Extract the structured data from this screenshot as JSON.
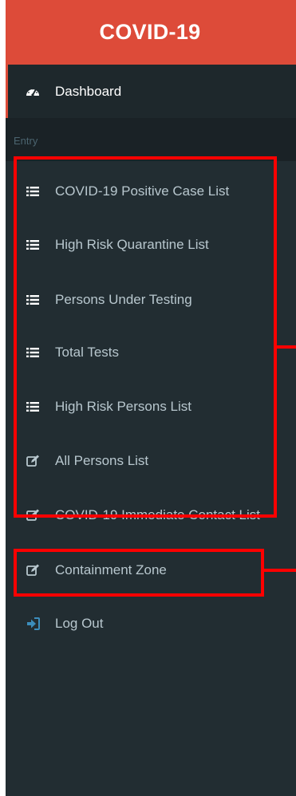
{
  "header": {
    "title": "COVID-19"
  },
  "sidebar": {
    "dashboard_label": "Dashboard",
    "section_label": "Entry",
    "items": [
      {
        "label": "COVID-19 Positive Case List",
        "icon": "list-icon"
      },
      {
        "label": "High Risk Quarantine List",
        "icon": "list-icon"
      },
      {
        "label": "Persons Under Testing",
        "icon": "list-icon"
      },
      {
        "label": "Total Tests",
        "icon": "list-icon"
      },
      {
        "label": "High Risk Persons List",
        "icon": "list-icon"
      },
      {
        "label": "All Persons List",
        "icon": "edit-icon"
      },
      {
        "label": "COVID-19 Immediate Contact List",
        "icon": "edit-icon"
      },
      {
        "label": "Containment Zone",
        "icon": "edit-icon"
      },
      {
        "label": "Log Out",
        "icon": "sign-out-icon"
      }
    ]
  },
  "colors": {
    "header_bg": "#dd4b39",
    "sidebar_bg": "#222d32",
    "active_bg": "#1e282c",
    "section_bg": "#1a2226",
    "text": "#b8c7ce",
    "annotation": "#ff0000",
    "logout_icon": "#3c8dbc"
  }
}
